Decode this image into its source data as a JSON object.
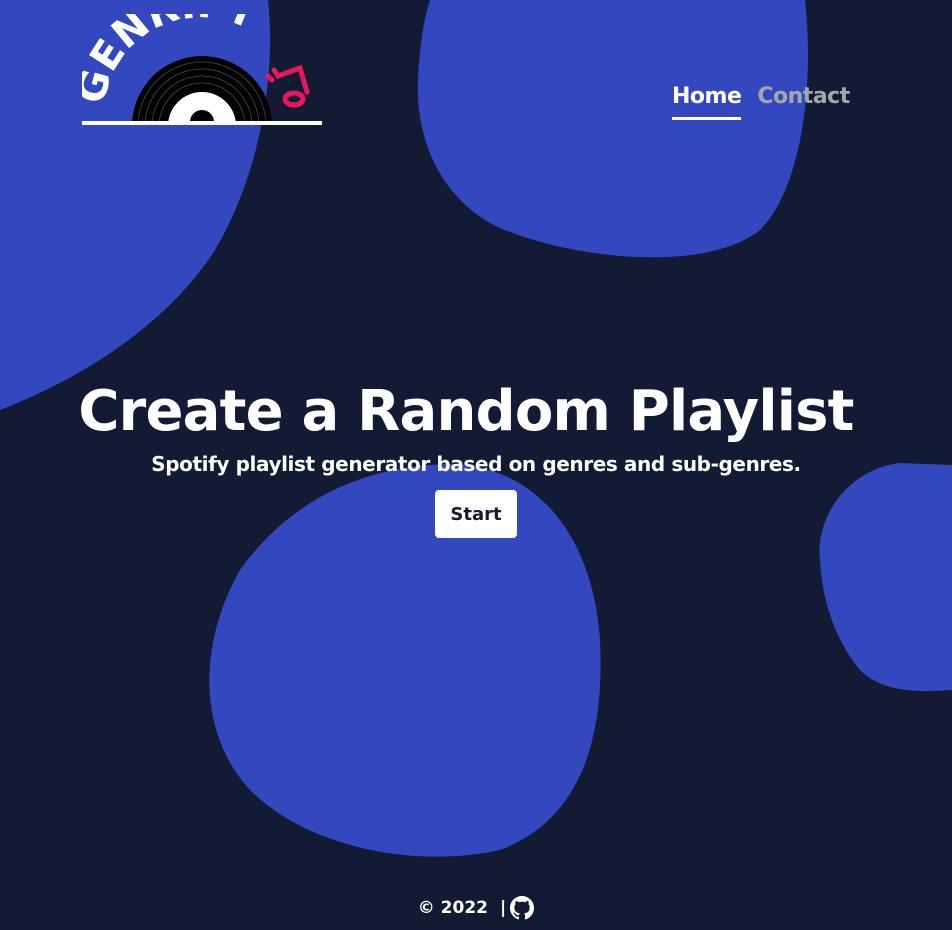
{
  "brand": {
    "logo_text": "GENRIFY",
    "logo_icon": "vinyl-record-music-note",
    "accent_color": "#e8175d"
  },
  "nav": {
    "home_label": "Home",
    "contact_label": "Contact",
    "active": "Home"
  },
  "hero": {
    "title": "Create a Random Playlist",
    "subtitle": "Spotify playlist generator based on genres and sub-genres.",
    "start_label": "Start"
  },
  "footer": {
    "copyright": "© 2022",
    "separator": "|",
    "github_icon": "github-icon"
  },
  "colors": {
    "background": "#131a33",
    "blob": "#3348bf",
    "text": "#ffffff",
    "nav_inactive": "#a6a6a6"
  }
}
